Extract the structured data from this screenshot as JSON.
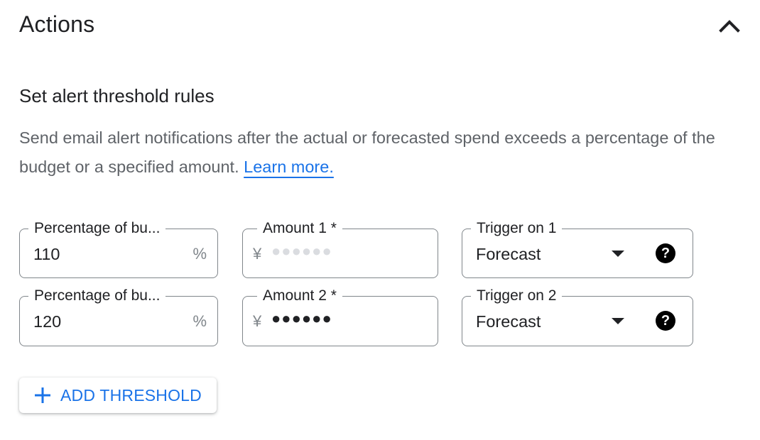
{
  "section": {
    "title": "Actions"
  },
  "alert_rules": {
    "subtitle": "Set alert threshold rules",
    "description": "Send email alert notifications after the actual or forecasted spend exceeds a percentage of the budget or a specified amount.",
    "learn_more": "Learn more."
  },
  "thresholds": [
    {
      "percentage_label": "Percentage of bu...",
      "percentage_value": "110",
      "percentage_suffix": "%",
      "amount_label": "Amount 1 *",
      "amount_prefix": "¥",
      "amount_masked": "●●●●●●",
      "trigger_label": "Trigger on 1",
      "trigger_value": "Forecast"
    },
    {
      "percentage_label": "Percentage of bu...",
      "percentage_value": "120",
      "percentage_suffix": "%",
      "amount_label": "Amount 2 *",
      "amount_prefix": "¥",
      "amount_masked": "●●●●●●",
      "trigger_label": "Trigger on 2",
      "trigger_value": "Forecast"
    }
  ],
  "add_threshold": {
    "label": "ADD THRESHOLD"
  },
  "icons": {
    "collapse": "chevron-up-icon",
    "dropdown": "arrow-drop-down-icon",
    "help": "help-icon",
    "add": "plus-icon"
  },
  "colors": {
    "accent": "#1a73e8",
    "border": "#80868b",
    "text": "#202124",
    "secondary_text": "#5f6368"
  }
}
